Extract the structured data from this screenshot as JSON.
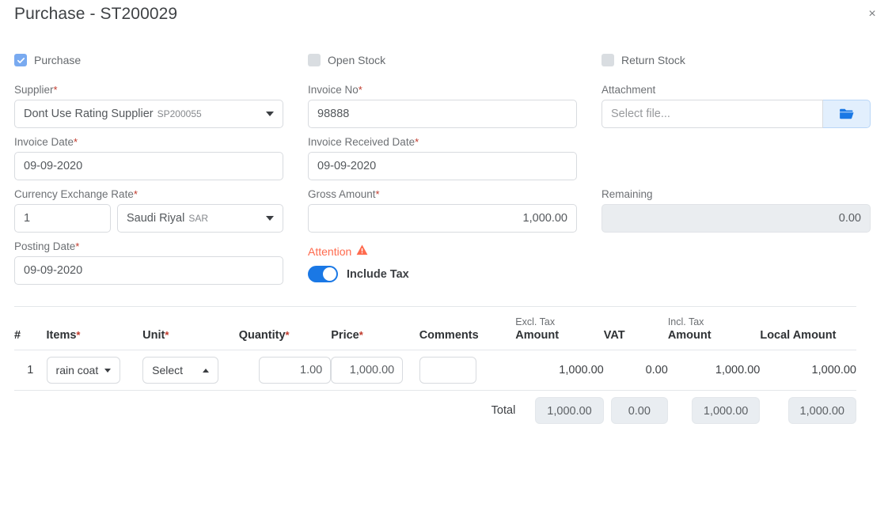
{
  "header": {
    "title": "Purchase - ST200029",
    "close_label": "×"
  },
  "checkboxes": [
    {
      "label": "Purchase",
      "checked": true
    },
    {
      "label": "Open Stock",
      "checked": false
    },
    {
      "label": "Return Stock",
      "checked": false
    }
  ],
  "fields": {
    "supplier": {
      "label": "Supplier",
      "required": "*",
      "value": "Dont Use Rating Supplier",
      "code": "SP200055"
    },
    "invoice_no": {
      "label": "Invoice No",
      "required": "*",
      "value": "98888"
    },
    "attachment": {
      "label": "Attachment",
      "placeholder": "Select file...",
      "button_icon": "folder-open-icon"
    },
    "invoice_date": {
      "label": "Invoice Date",
      "required": "*",
      "value": "09-09-2020"
    },
    "invoice_received_date": {
      "label": "Invoice Received Date",
      "required": "*",
      "value": "09-09-2020"
    },
    "currency_exchange_rate": {
      "label": "Currency Exchange Rate",
      "required": "*",
      "rate": "1",
      "currency": "Saudi Riyal",
      "currency_code": "SAR"
    },
    "gross_amount": {
      "label": "Gross Amount",
      "required": "*",
      "value": "1,000.00"
    },
    "remaining": {
      "label": "Remaining",
      "value": "0.00"
    },
    "posting_date": {
      "label": "Posting Date",
      "required": "*",
      "value": "09-09-2020"
    },
    "attention": {
      "label": "Attention",
      "icon": "warning-triangle-icon",
      "color": "#ff6a4d"
    },
    "include_tax": {
      "label": "Include Tax",
      "on": true
    }
  },
  "table": {
    "headers": {
      "index": "#",
      "items": "Items",
      "items_required": "*",
      "unit": "Unit",
      "unit_required": "*",
      "quantity": "Quantity",
      "quantity_required": "*",
      "price": "Price",
      "price_required": "*",
      "comments": "Comments",
      "excl_tax_pre": "Excl. Tax",
      "excl_tax_amount": "Amount",
      "vat": "VAT",
      "incl_tax_pre": "Incl. Tax",
      "incl_tax_amount": "Amount",
      "local_amount": "Local Amount"
    },
    "rows": [
      {
        "index": "1",
        "item": "rain coat",
        "unit": "Select",
        "quantity": "1.00",
        "price": "1,000.00",
        "comments": "",
        "excl_tax_amount": "1,000.00",
        "vat": "0.00",
        "incl_tax_amount": "1,000.00",
        "local_amount": "1,000.00"
      }
    ],
    "totals": {
      "label": "Total",
      "excl_tax_amount": "1,000.00",
      "vat": "0.00",
      "incl_tax_amount": "1,000.00",
      "local_amount": "1,000.00"
    }
  },
  "colors": {
    "accent": "#1a78e5",
    "checkbox_on": "#79aaf0",
    "attention": "#ff6a4d",
    "required": "#c0392b"
  }
}
